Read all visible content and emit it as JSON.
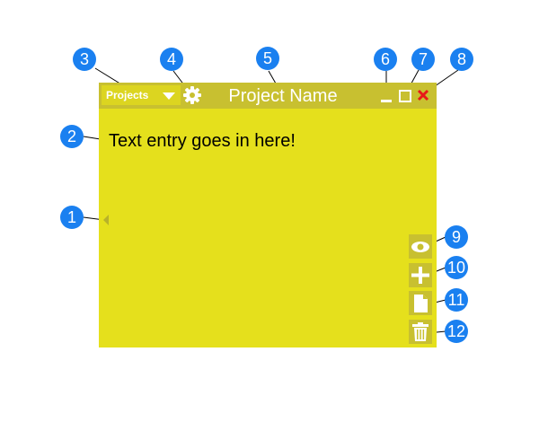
{
  "window": {
    "background_color": "#e5e01c",
    "titlebar_color": "#c8c030",
    "projects_label": "Projects",
    "title": "Project Name",
    "entry_text": "Text entry goes in here!",
    "icons": {
      "projects_dropdown": "chevron-down-icon",
      "settings": "gear-icon",
      "minimize": "minimize-icon",
      "maximize": "maximize-icon",
      "close": "close-icon",
      "collapse": "collapse-arrow-icon",
      "view": "eye-icon",
      "add": "plus-icon",
      "new_document": "document-icon",
      "delete": "trash-icon"
    }
  },
  "callouts": {
    "color": "#1a80f0",
    "labels": [
      "1",
      "2",
      "3",
      "4",
      "5",
      "6",
      "7",
      "8",
      "9",
      "10",
      "11",
      "12"
    ]
  }
}
